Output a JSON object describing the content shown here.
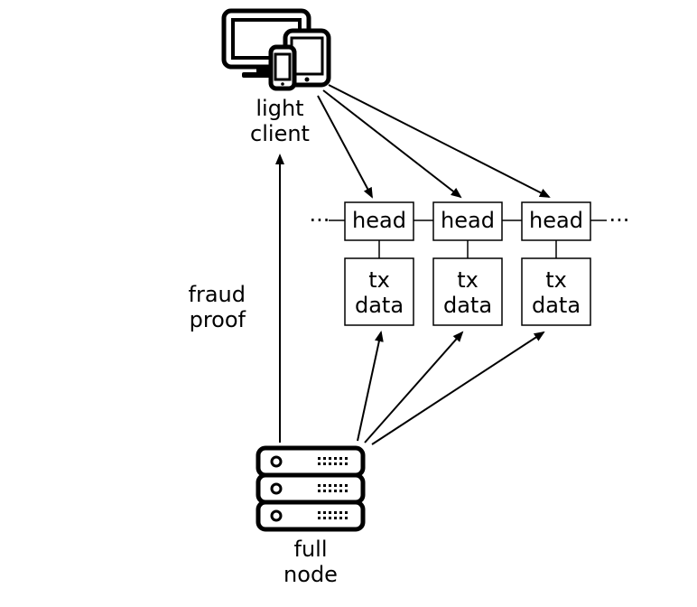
{
  "light_client": {
    "line1": "light",
    "line2": "client"
  },
  "full_node": {
    "line1": "full",
    "line2": "node"
  },
  "fraud_proof_label": {
    "line1": "fraud",
    "line2": "proof"
  },
  "blocks": {
    "left_dots": "···",
    "right_dots": "···",
    "head_label": "head",
    "tx_label_line1": "tx",
    "tx_label_line2": "data"
  }
}
